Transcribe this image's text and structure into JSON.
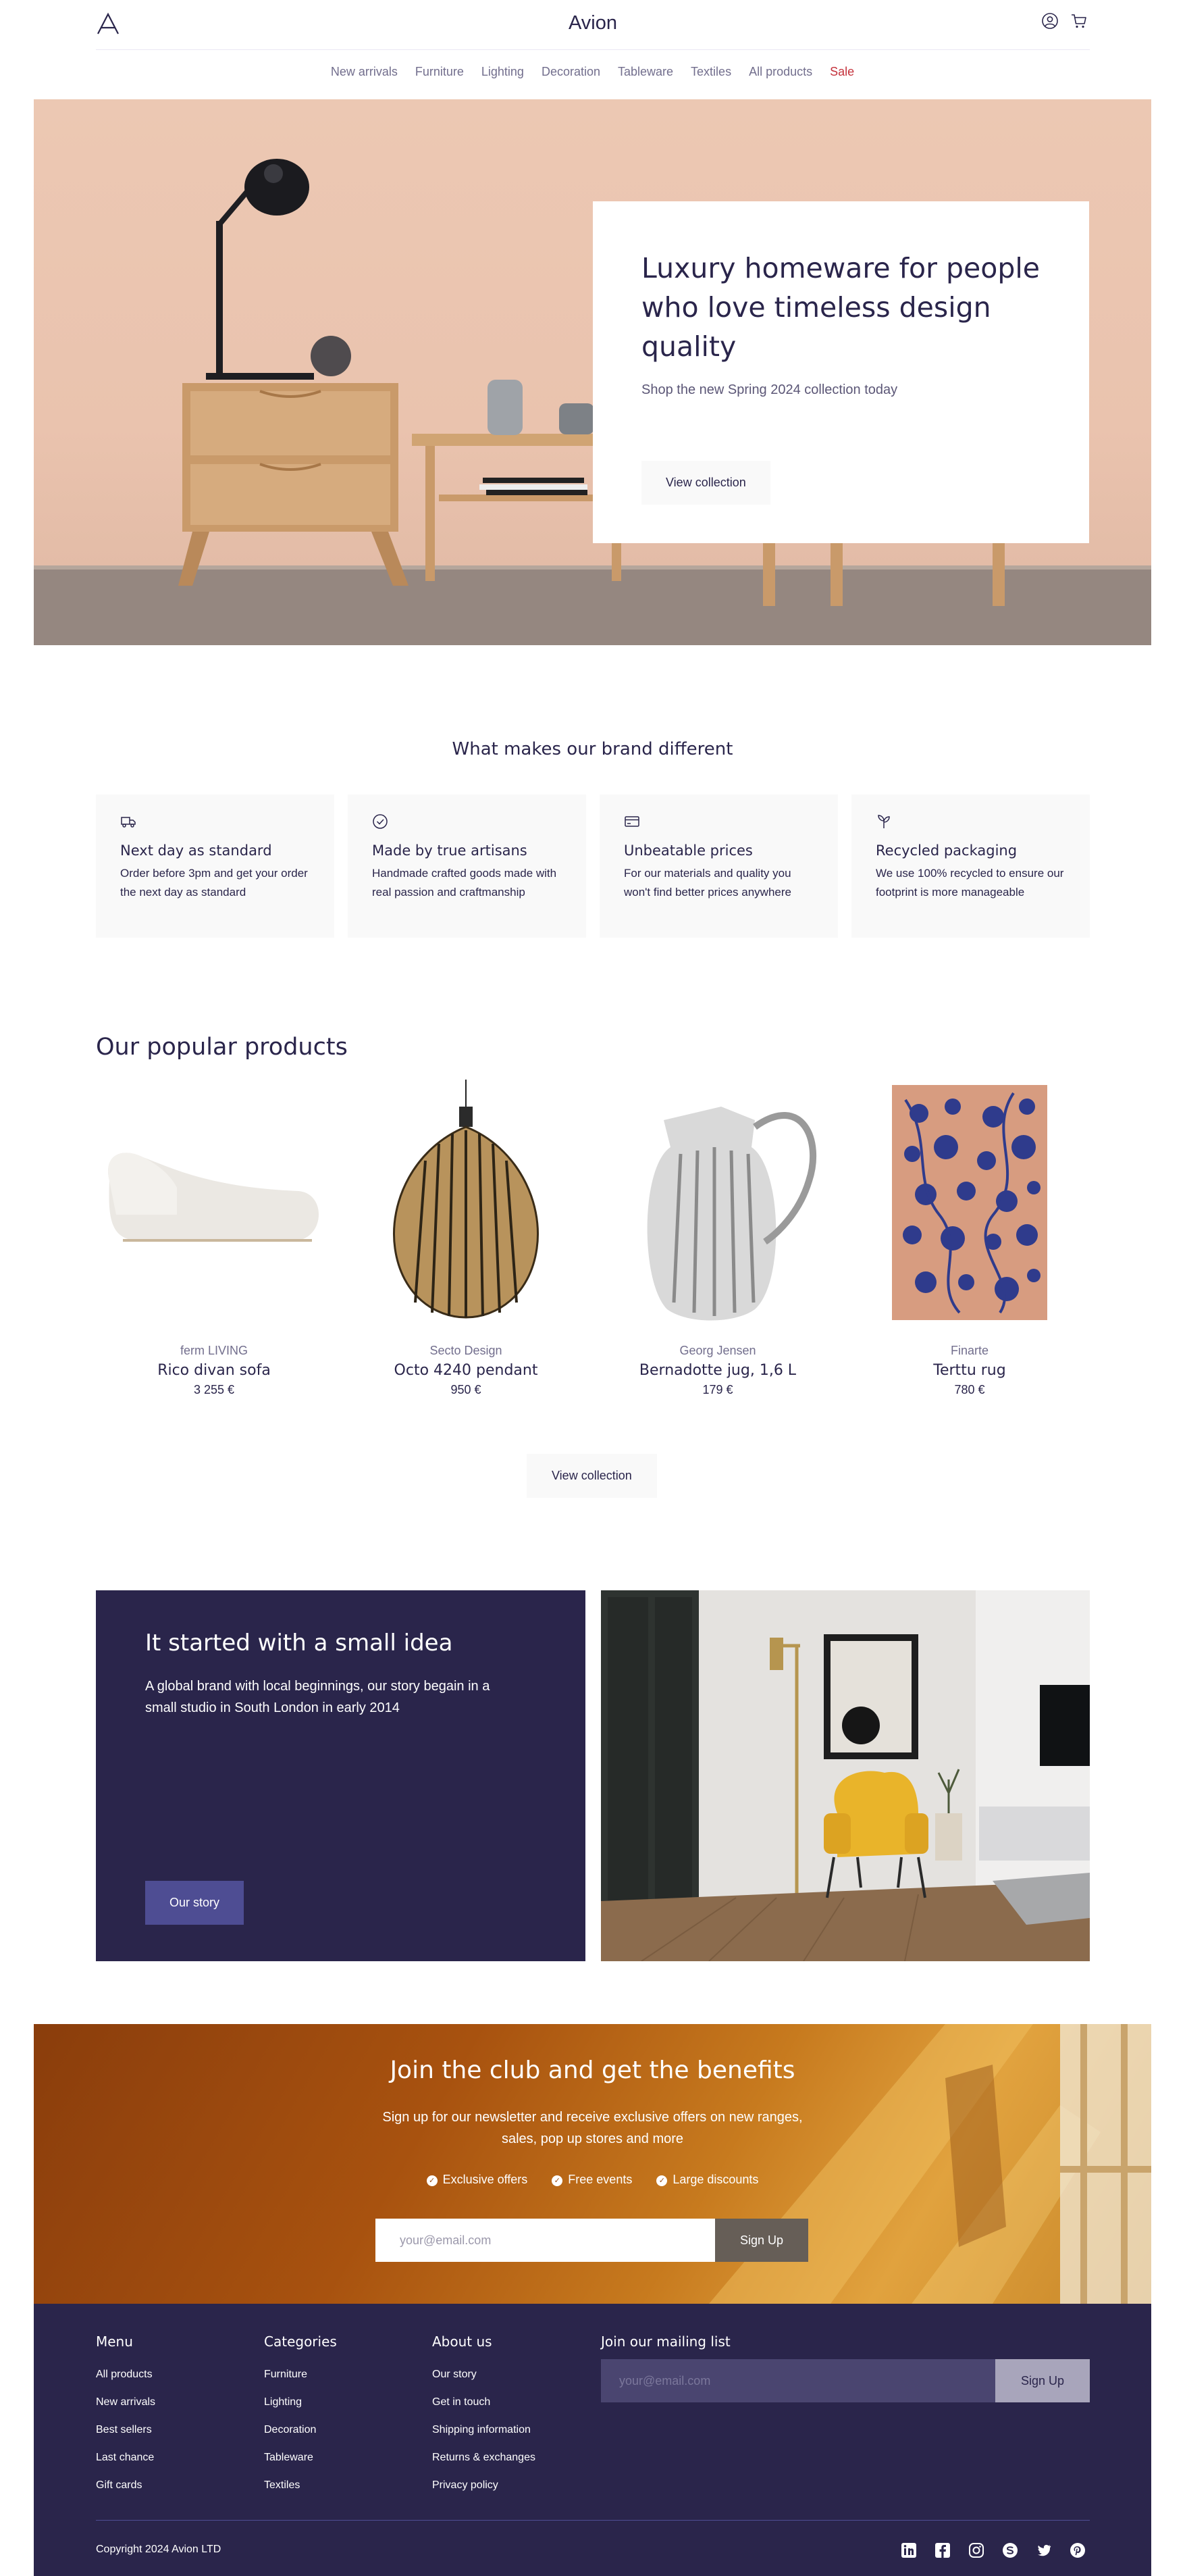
{
  "header": {
    "brand": "Avion",
    "logo_icon": "avion-logo-icon",
    "account_icon": "user-circle-icon",
    "cart_icon": "shopping-cart-icon"
  },
  "nav": {
    "items": [
      "New arrivals",
      "Furniture",
      "Lighting",
      "Decoration",
      "Tableware",
      "Textiles",
      "All products"
    ],
    "sale": "Sale"
  },
  "hero": {
    "title": "Luxury homeware for people who love timeless design quality",
    "subtitle": "Shop the new Spring 2024 collection today",
    "button": "View collection"
  },
  "features": {
    "title": "What makes our brand different",
    "items": [
      {
        "icon": "delivery-truck-icon",
        "title": "Next day as standard",
        "text": "Order before 3pm and get your order the next day as standard"
      },
      {
        "icon": "checkmark-circle-icon",
        "title": "Made by true artisans",
        "text": "Handmade crafted goods made with real passion and craftmanship"
      },
      {
        "icon": "credit-card-icon",
        "title": "Unbeatable prices",
        "text": "For our materials and quality you won't find better prices anywhere"
      },
      {
        "icon": "sprout-icon",
        "title": "Recycled packaging",
        "text": "We use 100% recycled to ensure our footprint is more manageable"
      }
    ]
  },
  "products": {
    "title": "Our popular products",
    "items": [
      {
        "maker": "ferm LIVING",
        "name": "Rico divan sofa",
        "price": "3 255 €"
      },
      {
        "maker": "Secto Design",
        "name": "Octo 4240 pendant",
        "price": "950 €"
      },
      {
        "maker": "Georg Jensen",
        "name": "Bernadotte jug, 1,6 L",
        "price": "179 €"
      },
      {
        "maker": "Finarte",
        "name": "Terttu rug",
        "price": "780 €"
      }
    ],
    "button": "View collection"
  },
  "story": {
    "title": "It started with a small idea",
    "text": "A global brand with local beginnings, our story begain in a small studio in South London in early 2014",
    "button": "Our story"
  },
  "club": {
    "title": "Join the club and get the benefits",
    "subtitle": "Sign up for our newsletter and receive exclusive offers on new ranges, sales, pop up stores and more",
    "benefits": [
      "Exclusive offers",
      "Free events",
      "Large discounts"
    ],
    "email_placeholder": "your@email.com",
    "button": "Sign Up"
  },
  "footer": {
    "menu": {
      "title": "Menu",
      "items": [
        "All products",
        "New arrivals",
        "Best sellers",
        "Last chance",
        "Gift cards"
      ]
    },
    "categories": {
      "title": "Categories",
      "items": [
        "Furniture",
        "Lighting",
        "Decoration",
        "Tableware",
        "Textiles"
      ]
    },
    "about": {
      "title": "About us",
      "items": [
        "Our story",
        "Get in touch",
        "Shipping information",
        "Returns & exchanges",
        "Privacy policy"
      ]
    },
    "mailing": {
      "title": "Join our mailing list",
      "placeholder": "your@email.com",
      "button": "Sign Up"
    },
    "copyright": "Copyright 2024 Avion LTD",
    "social_icons": [
      "linkedin-icon",
      "facebook-icon",
      "instagram-icon",
      "skype-icon",
      "twitter-icon",
      "pinterest-icon"
    ]
  }
}
